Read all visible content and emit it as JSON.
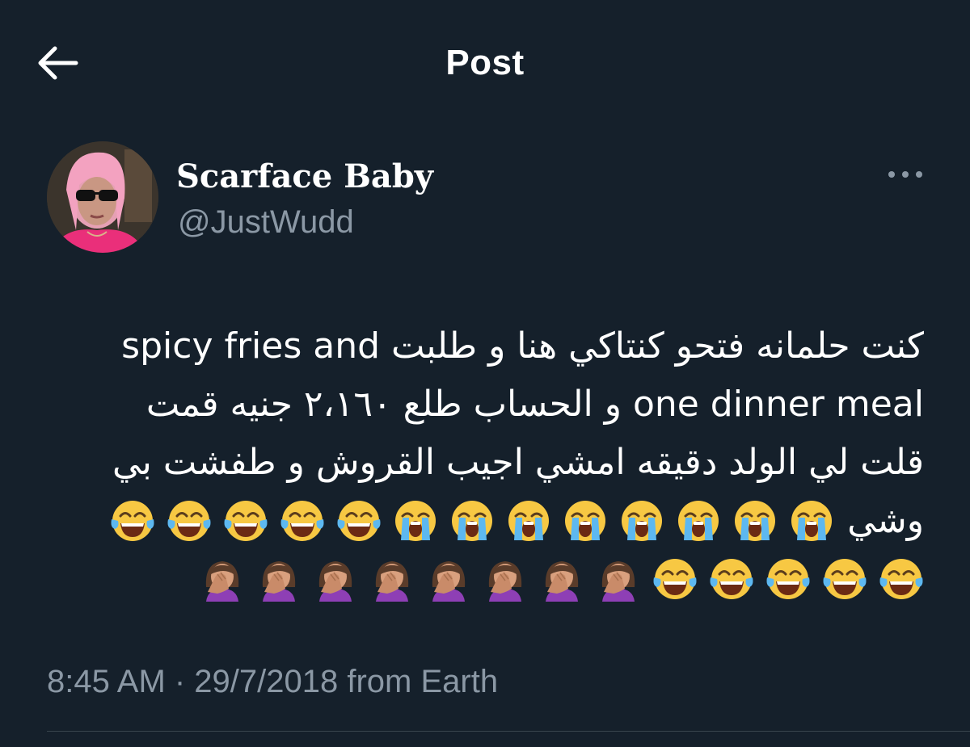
{
  "header": {
    "title": "Post",
    "back_icon": "arrow-left-icon"
  },
  "author": {
    "display_name": "Scarface Baby",
    "handle": "@JustWudd",
    "more_icon": "more-horizontal-icon"
  },
  "tweet": {
    "lines": [
      "كنت حلمانه فتحو كنتاكي هنا و طلبت spicy fries and",
      "one dinner meal و الحساب طلع ٢،١٦٠ جنيه قمت",
      "قلت لي الولد دقيقه امشي اجيب القروش و طفشت بي"
    ],
    "line4_text": "وشي",
    "line4_emojis": [
      "loudly-crying-face",
      "loudly-crying-face",
      "loudly-crying-face",
      "loudly-crying-face",
      "loudly-crying-face",
      "loudly-crying-face",
      "loudly-crying-face",
      "loudly-crying-face",
      "face-with-tears-of-joy",
      "face-with-tears-of-joy",
      "face-with-tears-of-joy",
      "face-with-tears-of-joy",
      "face-with-tears-of-joy"
    ],
    "line5_emojis": [
      "face-with-tears-of-joy",
      "face-with-tears-of-joy",
      "face-with-tears-of-joy",
      "face-with-tears-of-joy",
      "face-with-tears-of-joy",
      "woman-facepalming",
      "woman-facepalming",
      "woman-facepalming",
      "woman-facepalming",
      "woman-facepalming",
      "woman-facepalming",
      "woman-facepalming",
      "woman-facepalming"
    ]
  },
  "meta": {
    "timestamp": "8:45 AM · 29/7/2018 from Earth"
  },
  "colors": {
    "background": "#15202b",
    "text": "#ffffff",
    "secondary_text": "#8b98a5",
    "divider": "#38444d"
  }
}
